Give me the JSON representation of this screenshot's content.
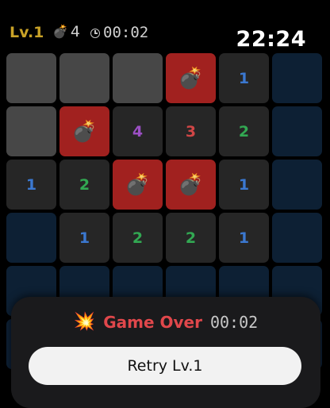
{
  "header": {
    "level": "Lv.1",
    "bomb_icon": "bomb-icon",
    "bombs": "4",
    "timer_icon": "clock-icon",
    "time": "00:02"
  },
  "system": {
    "clock": "22:24"
  },
  "colors": {
    "level": "#c9a227",
    "bomb_tile": "#a1211f",
    "closed_tile": "#474747",
    "hidden_tile": "#0d2034",
    "open_tile": "#262626",
    "game_over": "#e0474b"
  },
  "number_colors": {
    "1": "#3b78d0",
    "2": "#32a852",
    "3": "#d04646",
    "4": "#9b4fc4"
  },
  "board": {
    "rows": [
      [
        {
          "state": "closed"
        },
        {
          "state": "closed"
        },
        {
          "state": "closed"
        },
        {
          "state": "bomb"
        },
        {
          "state": "open",
          "value": "1"
        },
        {
          "state": "hidden"
        }
      ],
      [
        {
          "state": "closed"
        },
        {
          "state": "bomb"
        },
        {
          "state": "open",
          "value": "4"
        },
        {
          "state": "open",
          "value": "3"
        },
        {
          "state": "open",
          "value": "2"
        },
        {
          "state": "hidden"
        }
      ],
      [
        {
          "state": "open",
          "value": "1"
        },
        {
          "state": "open",
          "value": "2"
        },
        {
          "state": "bomb"
        },
        {
          "state": "bomb"
        },
        {
          "state": "open",
          "value": "1"
        },
        {
          "state": "hidden"
        }
      ],
      [
        {
          "state": "hidden"
        },
        {
          "state": "open",
          "value": "1"
        },
        {
          "state": "open",
          "value": "2"
        },
        {
          "state": "open",
          "value": "2"
        },
        {
          "state": "open",
          "value": "1"
        },
        {
          "state": "hidden"
        }
      ],
      [
        {
          "state": "hidden"
        },
        {
          "state": "hidden"
        },
        {
          "state": "hidden"
        },
        {
          "state": "hidden"
        },
        {
          "state": "hidden"
        },
        {
          "state": "hidden"
        }
      ],
      [
        {
          "state": "hidden"
        },
        {
          "state": "hidden"
        },
        {
          "state": "hidden"
        },
        {
          "state": "hidden"
        },
        {
          "state": "hidden"
        },
        {
          "state": "hidden"
        }
      ]
    ]
  },
  "overlay": {
    "icon": "explosion-icon",
    "title": "Game Over",
    "time": "00:02",
    "retry_label": "Retry Lv.1"
  }
}
